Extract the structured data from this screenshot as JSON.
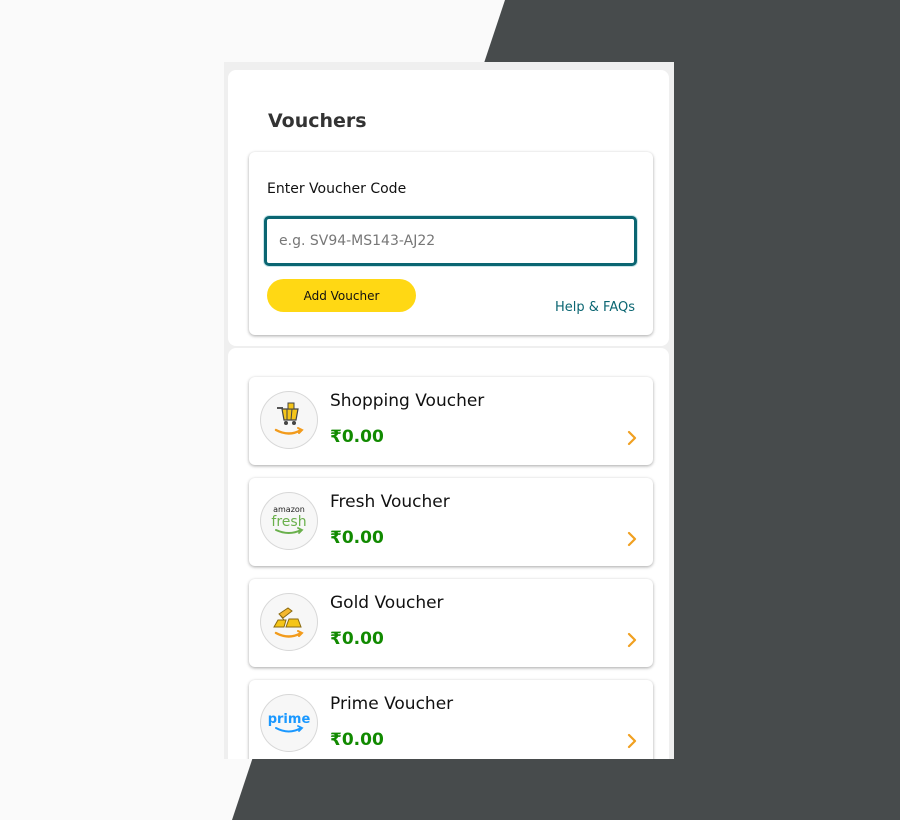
{
  "page": {
    "title": "Vouchers"
  },
  "voucher_entry": {
    "label": "Enter Voucher Code",
    "input_value": "",
    "input_placeholder": "e.g. SV94-MS143-AJ22",
    "add_button_label": "Add Voucher",
    "help_link_label": "Help & FAQs"
  },
  "vouchers": [
    {
      "name": "Shopping Voucher",
      "value": "₹0.00",
      "icon": "shopping-cart-icon"
    },
    {
      "name": "Fresh Voucher",
      "value": "₹0.00",
      "icon": "amazon-fresh-logo"
    },
    {
      "name": "Gold Voucher",
      "value": "₹0.00",
      "icon": "gold-bar-icon"
    },
    {
      "name": "Prime Voucher",
      "value": "₹0.00",
      "icon": "amazon-prime-logo"
    }
  ],
  "logo_text": {
    "fresh_small": "amazon",
    "fresh_big": "fresh",
    "prime": "prime"
  },
  "colors": {
    "accent_teal": "#0b6672",
    "button_yellow": "#ffd814",
    "value_green": "#118a00",
    "chevron_orange": "#f0a020",
    "background_dark": "#474b4c"
  }
}
